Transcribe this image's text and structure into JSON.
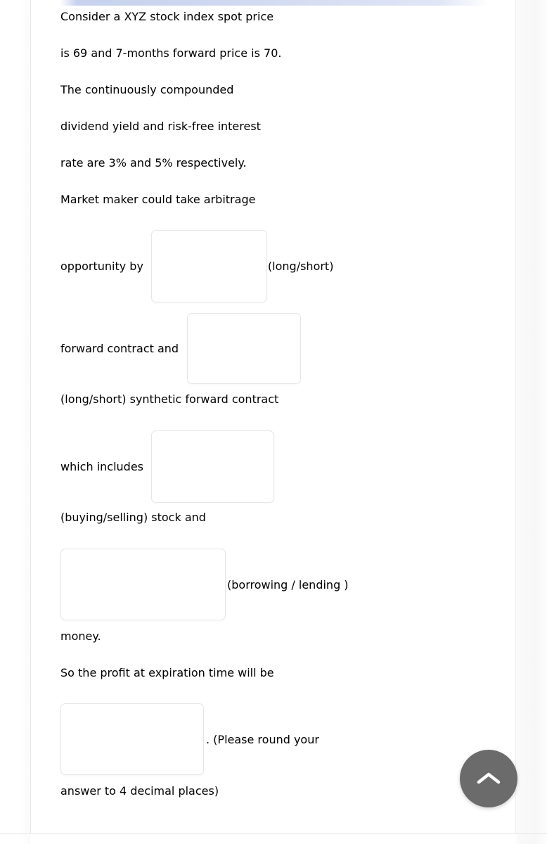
{
  "page": {
    "accent_color": "#ccd6f0",
    "text_color": "#3b3b3b",
    "background_color": "#ffffff",
    "box_border_color": "#e6e6e6"
  },
  "question": {
    "line1": "Consider a XYZ stock index spot price",
    "line2": "is 69 and 7-months forward price is 70.",
    "line3": "The continuously compounded",
    "line4": "dividend yield and risk-free interest",
    "line5": "rate are 3% and 5% respectively.",
    "line6": "Market maker could take arbitrage",
    "line7_prefix": "opportunity by",
    "line7_suffix": "(long/short)",
    "line8_prefix": "forward contract and",
    "line9": "(long/short) synthetic forward contract",
    "line10_prefix": "which includes",
    "line11": "(buying/selling) stock and",
    "line12_suffix": "(borrowing / lending )",
    "line13": "money.",
    "line14": "So the profit at expiration time will be",
    "line15_suffix": ". (Please round your",
    "line16": "answer to 4 decimal places)"
  },
  "blanks": {
    "long_short_value": "",
    "long_short_placeholder": "",
    "forward_contract_value": "",
    "forward_contract_placeholder": "",
    "includes_value": "",
    "includes_placeholder": "",
    "borrow_lend_value": "",
    "borrow_lend_placeholder": "",
    "profit_value": "",
    "profit_placeholder": ""
  },
  "controls": {
    "scroll_top_icon": "chevron-up-icon",
    "scroll_top_color": "#6b6b6b"
  }
}
